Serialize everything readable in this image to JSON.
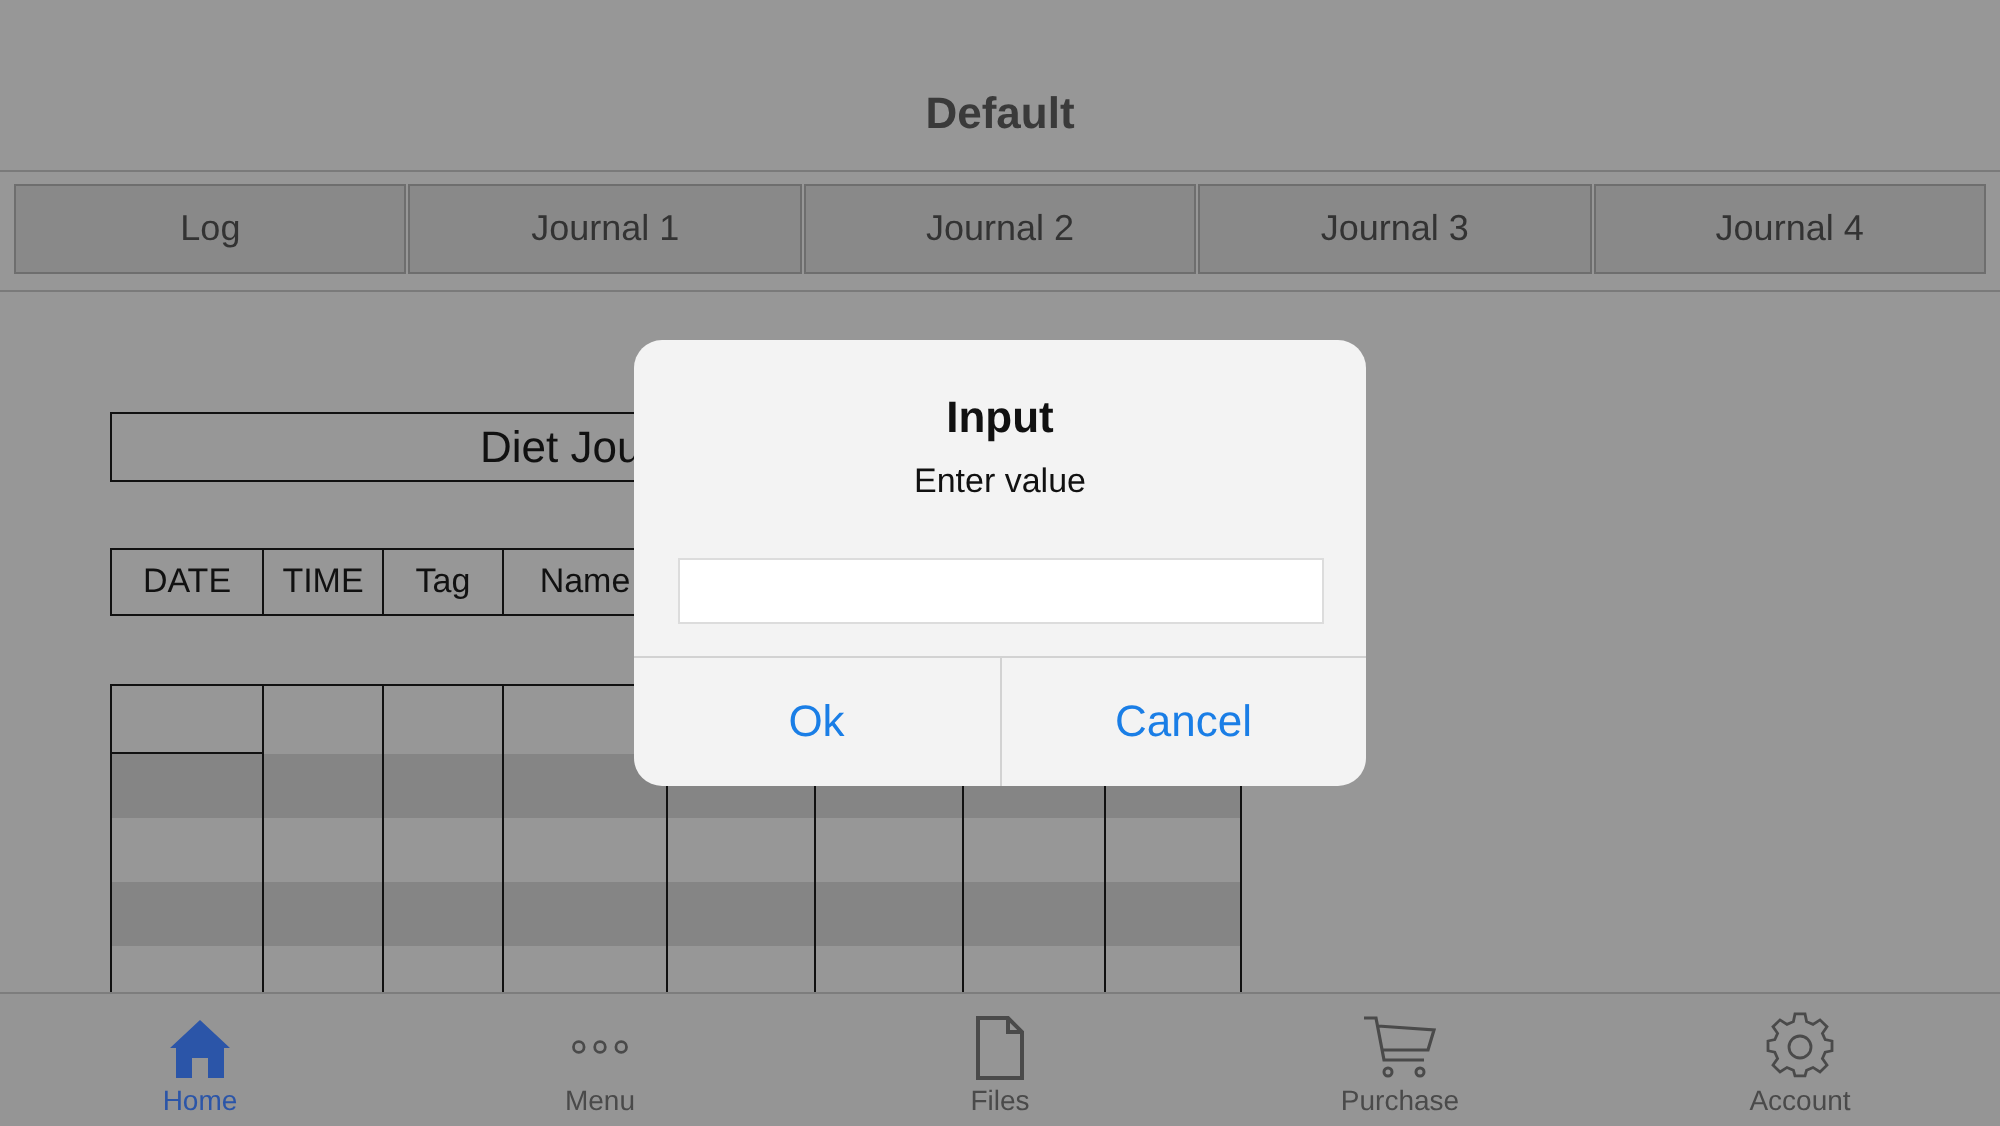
{
  "header": {
    "title": "Default"
  },
  "tabs": [
    {
      "label": "Log"
    },
    {
      "label": "Journal 1"
    },
    {
      "label": "Journal 2"
    },
    {
      "label": "Journal 3"
    },
    {
      "label": "Journal 4"
    }
  ],
  "journal": {
    "title": "Diet Jou",
    "columns": [
      "DATE",
      "TIME",
      "Tag",
      "Name"
    ]
  },
  "dialog": {
    "title": "Input",
    "message": "Enter value",
    "buttons": [
      "Ok",
      "Cancel"
    ]
  },
  "tab_bar": [
    {
      "kind": "home",
      "label": "Home",
      "selected": true
    },
    {
      "kind": "menu",
      "label": "Menu",
      "selected": false
    },
    {
      "kind": "files",
      "label": "Files",
      "selected": false
    },
    {
      "kind": "purchase",
      "label": "Purchase",
      "selected": false
    },
    {
      "kind": "account",
      "label": "Account",
      "selected": false
    }
  ]
}
